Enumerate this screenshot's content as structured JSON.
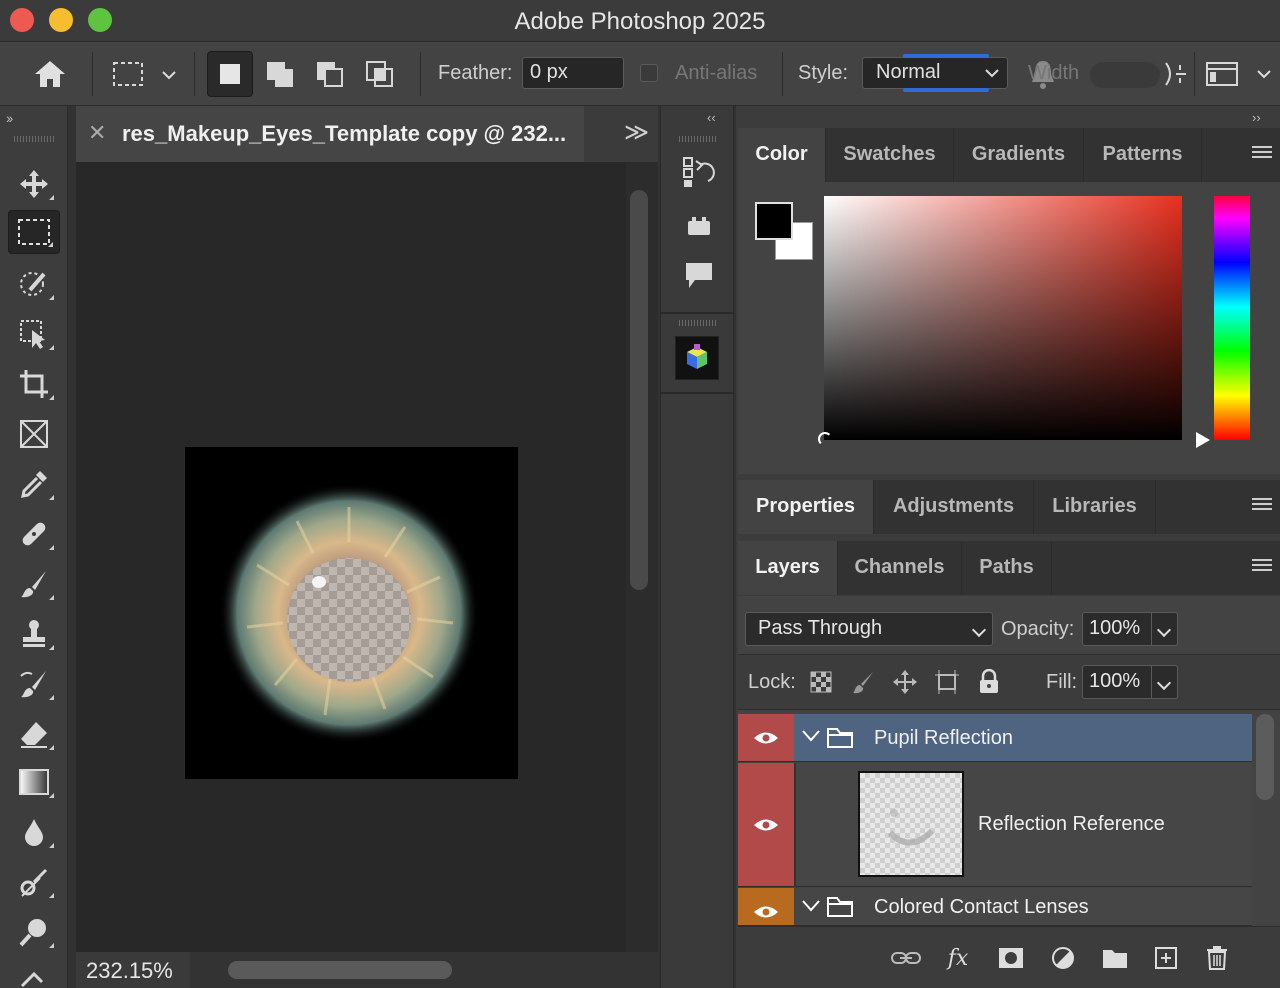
{
  "app": {
    "title": "Adobe Photoshop 2025"
  },
  "options": {
    "feather_label": "Feather:",
    "feather_value": "0 px",
    "antialias_label": "Anti-alias",
    "style_label": "Style:",
    "style_value": "Normal",
    "width_label": "Width"
  },
  "document": {
    "tab_title": "res_Makeup_Eyes_Template copy @ 232...",
    "zoom": "232.15%"
  },
  "color_panel": {
    "tabs": [
      "Color",
      "Swatches",
      "Gradients",
      "Patterns"
    ],
    "foreground": "#000000",
    "background": "#ffffff",
    "hue_color": "#e8301f"
  },
  "props_panel": {
    "tabs": [
      "Properties",
      "Adjustments",
      "Libraries"
    ]
  },
  "layers_panel": {
    "tabs": [
      "Layers",
      "Channels",
      "Paths"
    ],
    "blend_mode": "Pass Through",
    "opacity_label": "Opacity:",
    "opacity_value": "100%",
    "lock_label": "Lock:",
    "fill_label": "Fill:",
    "fill_value": "100%",
    "layers": [
      {
        "name": "Pupil Reflection",
        "type": "group",
        "selected": true,
        "eye_color": "#b24a4a"
      },
      {
        "name": "Reflection Reference",
        "type": "layer",
        "selected": false,
        "eye_color": "#b24a4a"
      },
      {
        "name": "Colored Contact Lenses",
        "type": "group",
        "selected": false,
        "eye_color": "#b86a1e"
      }
    ]
  }
}
